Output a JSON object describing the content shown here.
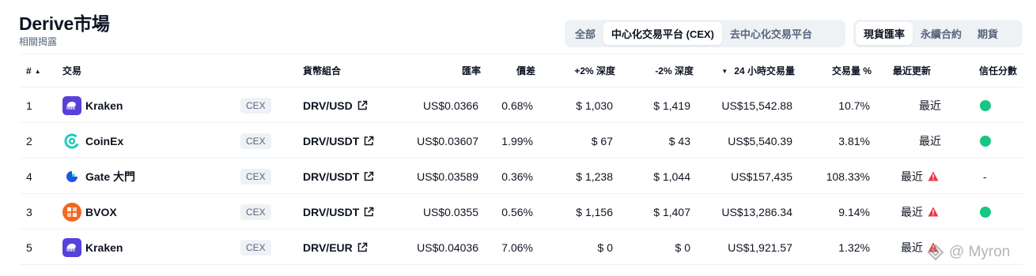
{
  "header": {
    "title": "Derive市場",
    "subtitle": "相關揭露"
  },
  "filters": {
    "type_tabs": [
      {
        "label": "全部",
        "active": false
      },
      {
        "label": "中心化交易平台 (CEX)",
        "active": true
      },
      {
        "label": "去中心化交易平台",
        "active": false
      }
    ],
    "market_tabs": [
      {
        "label": "現貨匯率",
        "active": true
      },
      {
        "label": "永續合約",
        "active": false
      },
      {
        "label": "期貨",
        "active": false
      }
    ]
  },
  "table": {
    "columns": {
      "rank": "#",
      "exchange": "交易",
      "pair": "貨幣組合",
      "price": "匯率",
      "spread": "價差",
      "depth_plus": "+2% 深度",
      "depth_minus": "-2% 深度",
      "volume": "24 小時交易量",
      "volume_pct": "交易量 %",
      "updated": "最近更新",
      "trust": "信任分數"
    },
    "rows": [
      {
        "rank": "1",
        "exchange": "Kraken",
        "logo": "kraken-logo",
        "type": "CEX",
        "pair": "DRV/USD",
        "price": "US$0.0366",
        "spread": "0.68%",
        "depth_plus": "$ 1,030",
        "depth_minus": "$ 1,419",
        "volume": "US$15,542.88",
        "volume_pct": "10.7%",
        "updated": "最近",
        "warning": false,
        "trust": "green"
      },
      {
        "rank": "2",
        "exchange": "CoinEx",
        "logo": "coinex-logo",
        "type": "CEX",
        "pair": "DRV/USDT",
        "price": "US$0.03607",
        "spread": "1.99%",
        "depth_plus": "$ 67",
        "depth_minus": "$ 43",
        "volume": "US$5,540.39",
        "volume_pct": "3.81%",
        "updated": "最近",
        "warning": false,
        "trust": "green"
      },
      {
        "rank": "4",
        "exchange": "Gate 大門",
        "logo": "gate-logo",
        "type": "CEX",
        "pair": "DRV/USDT",
        "price": "US$0.03589",
        "spread": "0.36%",
        "depth_plus": "$ 1,238",
        "depth_minus": "$ 1,044",
        "volume": "US$157,435",
        "volume_pct": "108.33%",
        "updated": "最近",
        "warning": true,
        "trust": "-"
      },
      {
        "rank": "3",
        "exchange": "BVOX",
        "logo": "bvox-logo",
        "type": "CEX",
        "pair": "DRV/USDT",
        "price": "US$0.0355",
        "spread": "0.56%",
        "depth_plus": "$ 1,156",
        "depth_minus": "$ 1,407",
        "volume": "US$13,286.34",
        "volume_pct": "9.14%",
        "updated": "最近",
        "warning": true,
        "trust": "green"
      },
      {
        "rank": "5",
        "exchange": "Kraken",
        "logo": "kraken-logo",
        "type": "CEX",
        "pair": "DRV/EUR",
        "price": "US$0.04036",
        "spread": "7.06%",
        "depth_plus": "$ 0",
        "depth_minus": "$ 0",
        "volume": "US$1,921.57",
        "volume_pct": "1.32%",
        "updated": "最近",
        "warning": true,
        "trust": "none"
      }
    ]
  },
  "watermark": {
    "text": "@ Myron"
  },
  "colors": {
    "trust_green": "#16c784",
    "warning_red": "#ea3943",
    "kraken": "#5741d9",
    "coinex": "#21c8bc",
    "gate": "#2354e6",
    "bvox": "#f26722"
  }
}
